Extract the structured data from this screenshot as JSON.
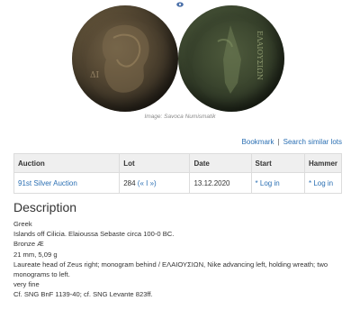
{
  "caption": "Image: Savoca Numismatik",
  "coin_obverse_text": "ΔΙ",
  "coin_reverse_text": "ΕΛΑΙΟΥΣΙΩΝ",
  "links": {
    "bookmark": "Bookmark",
    "separator": "|",
    "search_similar": "Search similar lots"
  },
  "table": {
    "headers": [
      "Auction",
      "Lot",
      "Date",
      "Start",
      "Hammer"
    ],
    "row": {
      "auction": "91st Silver Auction",
      "lot": "284",
      "lot_nav": "(« I »)",
      "date": "13.12.2020",
      "start": "* Log in",
      "hammer": "* Log in"
    }
  },
  "description": {
    "title": "Description",
    "lines": [
      "Greek",
      "Islands off Cilicia. Elaioussa Sebaste circa 100-0 BC.",
      "Bronze Æ",
      "21 mm, 5,09 g",
      "Laureate head of Zeus right; monogram behind / ΕΛΑΙΟΥΣΙΩΝ, Nike advancing left, holding wreath; two monograms to left.",
      "very fine",
      "Cf. SNG BnF 1139-40; cf. SNG Levante 823ff."
    ]
  },
  "colors": {
    "link": "#2a6fb3",
    "header_bg": "#efefef",
    "border": "#dcdcdc"
  }
}
